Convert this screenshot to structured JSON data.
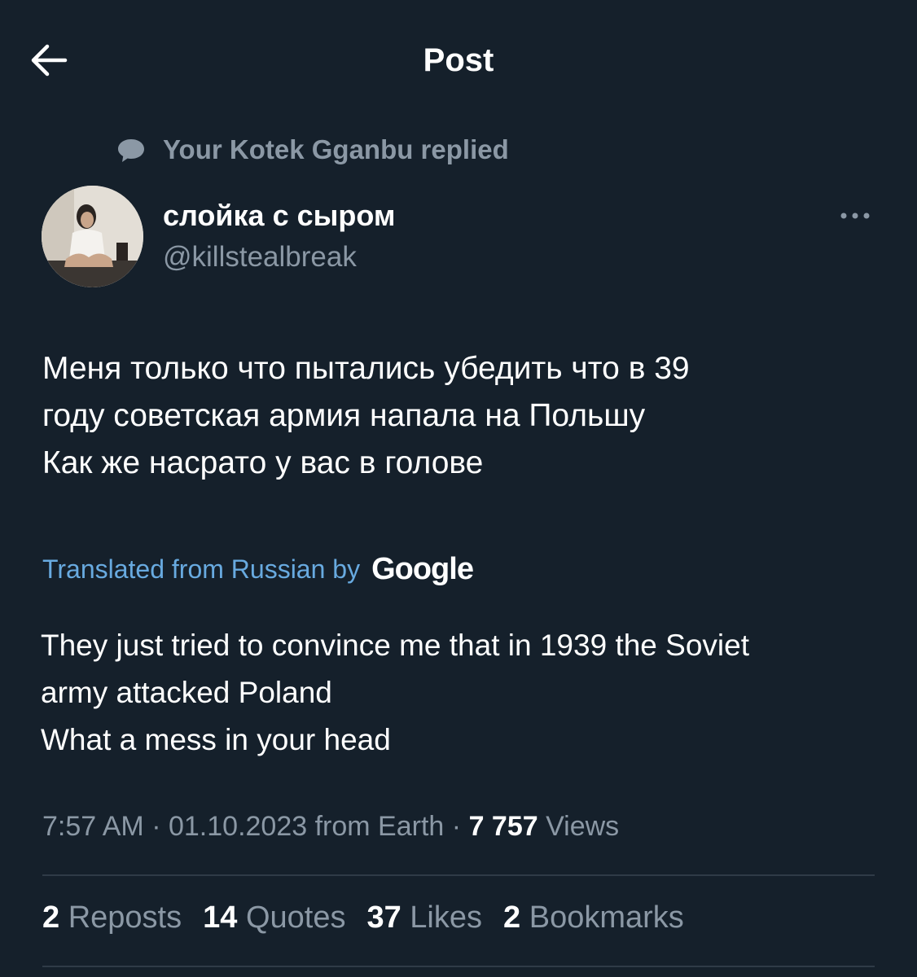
{
  "header": {
    "title": "Post",
    "back_icon": "arrow-left-icon"
  },
  "reply_context": {
    "text": "Your Kotek Gganbu replied",
    "icon": "speech-bubble-icon"
  },
  "author": {
    "display_name": "слойка с сыром",
    "handle": "@killstealbreak"
  },
  "post": {
    "lines": [
      "Меня только что пытались убедить что в 39",
      "году советская армия напала на Польшу",
      "Как же насрато у вас в голове"
    ]
  },
  "translation": {
    "label": "Translated from Russian by",
    "provider": "Google",
    "lines": [
      "They just tried to convince me that in 1939 the Soviet",
      "army attacked Poland",
      "What a mess in your head"
    ]
  },
  "meta": {
    "time": "7:57 AM",
    "date": "01.10.2023",
    "source": "from Earth",
    "views_count": "7 757",
    "views_label": "Views"
  },
  "stats": {
    "reposts": {
      "count": "2",
      "label": "Reposts"
    },
    "quotes": {
      "count": "14",
      "label": "Quotes"
    },
    "likes": {
      "count": "37",
      "label": "Likes"
    },
    "bookmarks": {
      "count": "2",
      "label": "Bookmarks"
    }
  },
  "colors": {
    "background": "#15202b",
    "secondary_text": "#8b98a5",
    "link_blue": "#68aae0",
    "divider": "#2f3b47"
  }
}
